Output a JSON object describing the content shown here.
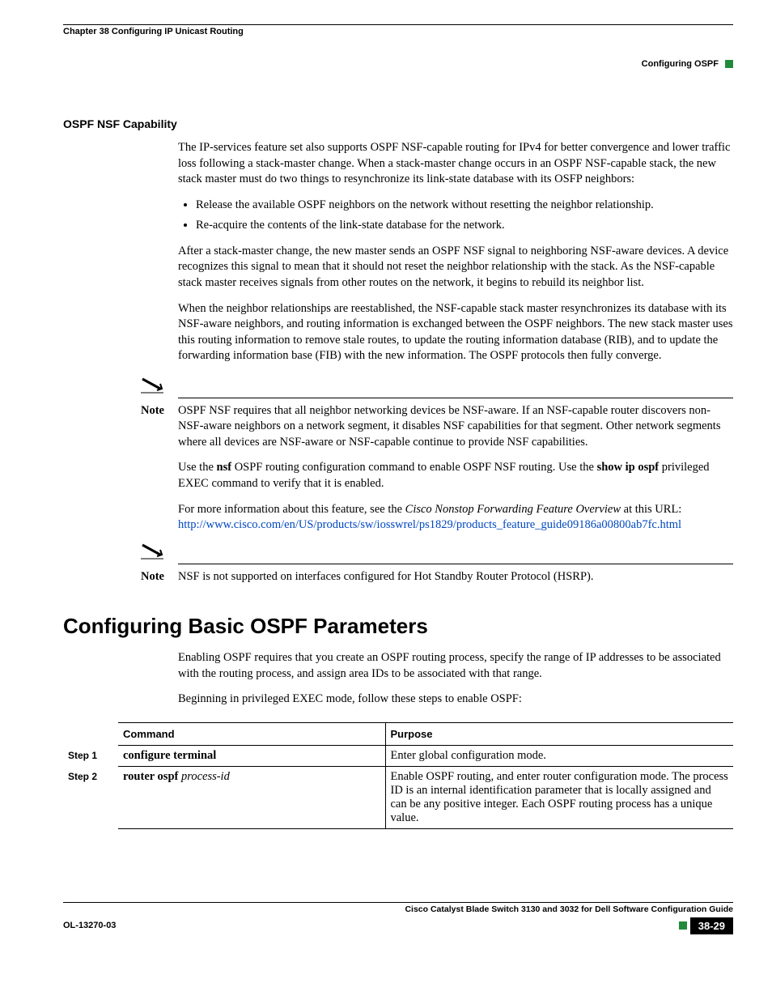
{
  "header": {
    "chapter": "Chapter 38      Configuring IP Unicast Routing",
    "section_right": "Configuring OSPF"
  },
  "subhead": "OSPF NSF Capability",
  "p1": "The IP-services feature set also supports OSPF NSF-capable routing for IPv4 for better convergence and lower traffic loss following a stack-master change. When a stack-master change occurs in an OSPF NSF-capable stack, the new stack master must do two things to resynchronize its link-state database with its OSFP neighbors:",
  "bul1": "Release the available OSPF neighbors on the network without resetting the neighbor relationship.",
  "bul2": "Re-acquire the contents of the link-state database for the network.",
  "p2": "After a stack-master change, the new master sends an OSPF NSF signal to neighboring NSF-aware devices. A device recognizes this signal to mean that it should not reset the neighbor relationship with the stack. As the NSF-capable stack master receives signals from other routes on the network, it begins to rebuild its neighbor list.",
  "p3": "When the neighbor relationships are reestablished, the NSF-capable stack master resynchronizes its database with its NSF-aware neighbors, and routing information is exchanged between the OSPF neighbors. The new stack master uses this routing information to remove stale routes, to update the routing information database (RIB), and to update the forwarding information base (FIB) with the new information. The OSPF protocols then fully converge.",
  "note_label": "Note",
  "note1": "OSPF NSF requires that all neighbor networking devices be NSF-aware. If an NSF-capable router discovers non-NSF-aware neighbors on a network segment, it disables NSF capabilities for that segment. Other network segments where all devices are NSF-aware or NSF-capable continue to provide NSF capabilities.",
  "p4_pre": "Use the ",
  "p4_cmd1": "nsf",
  "p4_mid": " OSPF routing configuration command to enable OSPF NSF routing. Use the ",
  "p4_cmd2": "show ip ospf",
  "p4_post": " privileged EXEC command to verify that it is enabled.",
  "p5_pre": "For more information about this feature, see the ",
  "p5_ital": "Cisco Nonstop Forwarding Feature Overview",
  "p5_post": " at this URL:",
  "p5_link": "http://www.cisco.com/en/US/products/sw/iosswrel/ps1829/products_feature_guide09186a00800ab7fc.html",
  "note2": "NSF is not supported on interfaces configured for Hot Standby Router Protocol (HSRP).",
  "h1": "Configuring Basic OSPF Parameters",
  "p6": "Enabling OSPF requires that you create an OSPF routing process, specify the range of IP addresses to be associated with the routing process, and assign area IDs to be associated with that range.",
  "p7": "Beginning in privileged EXEC mode, follow these steps to enable OSPF:",
  "table": {
    "head_cmd": "Command",
    "head_purpose": "Purpose",
    "rows": [
      {
        "step": "Step 1",
        "cmd_bold": "configure terminal",
        "cmd_ital": "",
        "purpose": "Enter global configuration mode."
      },
      {
        "step": "Step 2",
        "cmd_bold": "router ospf ",
        "cmd_ital": "process-id",
        "purpose": "Enable OSPF routing, and enter router configuration mode. The process ID is an internal identification parameter that is locally assigned and can be any positive integer. Each OSPF routing process has a unique value."
      }
    ]
  },
  "footer": {
    "guide": "Cisco Catalyst Blade Switch 3130 and 3032 for Dell Software Configuration Guide",
    "docnum": "OL-13270-03",
    "pagenum": "38-29"
  }
}
